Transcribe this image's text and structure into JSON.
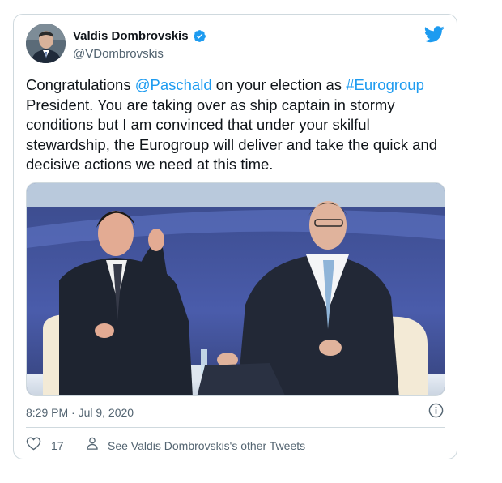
{
  "author": {
    "name": "Valdis Dombrovskis",
    "handle": "@VDombrovskis"
  },
  "tweet": {
    "segments": [
      {
        "text": "Congratulations ",
        "link": false
      },
      {
        "text": "@Paschald",
        "link": true
      },
      {
        "text": " on your election as ",
        "link": false
      },
      {
        "text": "#Eurogroup",
        "link": true
      },
      {
        "text": " President. You are taking over as ship captain in stormy conditions but I am convinced that under your skilful stewardship, the Eurogroup will deliver and take the quick and decisive actions we need at this time.",
        "link": false
      }
    ]
  },
  "meta": {
    "timestamp": "8:29 PM · Jul 9, 2020"
  },
  "actions": {
    "like_count": "17",
    "other_tweets_label": "See Valdis Dombrovskis's other Tweets"
  },
  "colors": {
    "accent": "#1d9bf0",
    "text": "#0f1419",
    "muted": "#536471",
    "border": "#cfd9de"
  },
  "icons": {
    "brand": "twitter-bird-icon",
    "verified": "verified-badge-icon",
    "info": "info-icon",
    "like": "heart-icon",
    "profile": "person-icon"
  }
}
